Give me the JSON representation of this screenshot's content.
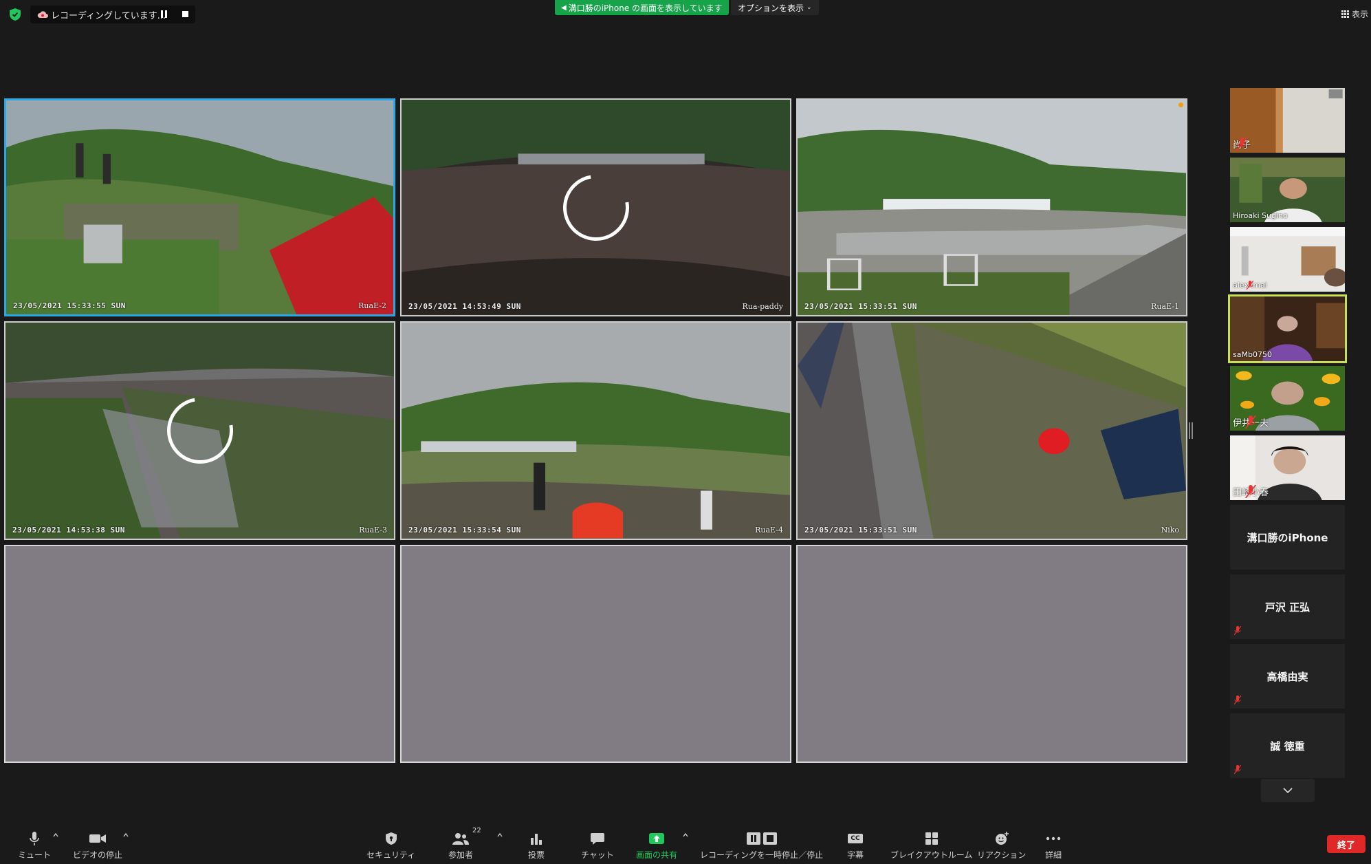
{
  "top_bar": {
    "recording_label": "レコーディングしています...",
    "share_banner": "溝口勝のiPhone の画面を表示しています",
    "options_label": "オプションを表示",
    "view_label": "表示"
  },
  "tiles": [
    {
      "timestamp": "23/05/2021 15:33:55 SUN",
      "camera": "RuaE-2",
      "active": true
    },
    {
      "timestamp": "23/05/2021 14:53:49 SUN",
      "camera": "Rua-paddy",
      "loading": true
    },
    {
      "timestamp": "23/05/2021 15:33:51 SUN",
      "camera": "RuaE-1"
    },
    {
      "timestamp": "23/05/2021 14:53:38 SUN",
      "camera": "RuaE-3",
      "loading": true
    },
    {
      "timestamp": "23/05/2021 15:33:54 SUN",
      "camera": "RuaE-4"
    },
    {
      "timestamp": "23/05/2021 15:33:51 SUN",
      "camera": "Niko"
    }
  ],
  "participants": [
    {
      "name": "尚子",
      "muted": true
    },
    {
      "name": "Hiroaki Sugino",
      "muted": false
    },
    {
      "name": "alex imai",
      "muted": true
    },
    {
      "name": "saMb0750",
      "muted": false,
      "speaking": true
    },
    {
      "name": "伊井一夫",
      "muted": true
    },
    {
      "name": "田崎小春",
      "muted": true
    },
    {
      "name": "溝口勝のiPhone",
      "muted": false
    },
    {
      "name": "戸沢 正弘",
      "muted": true
    },
    {
      "name": "高橋由実",
      "muted": true
    },
    {
      "name": "誠 徳重",
      "muted": true
    }
  ],
  "toolbar": {
    "mute": "ミュート",
    "video": "ビデオの停止",
    "security": "セキュリティ",
    "participants": "参加者",
    "participants_count": "22",
    "poll": "投票",
    "chat": "チャット",
    "share": "画面の共有",
    "recording": "レコーディングを一時停止／停止",
    "captions": "字幕",
    "captions_icon": "CC",
    "breakout": "ブレイクアウトルーム",
    "reactions": "リアクション",
    "more": "詳細",
    "end": "終了"
  },
  "colors": {
    "active_border": "#2aa7e6",
    "speaker_border": "#c7e05a",
    "share_green": "#16a34a",
    "end_red": "#e02828"
  }
}
